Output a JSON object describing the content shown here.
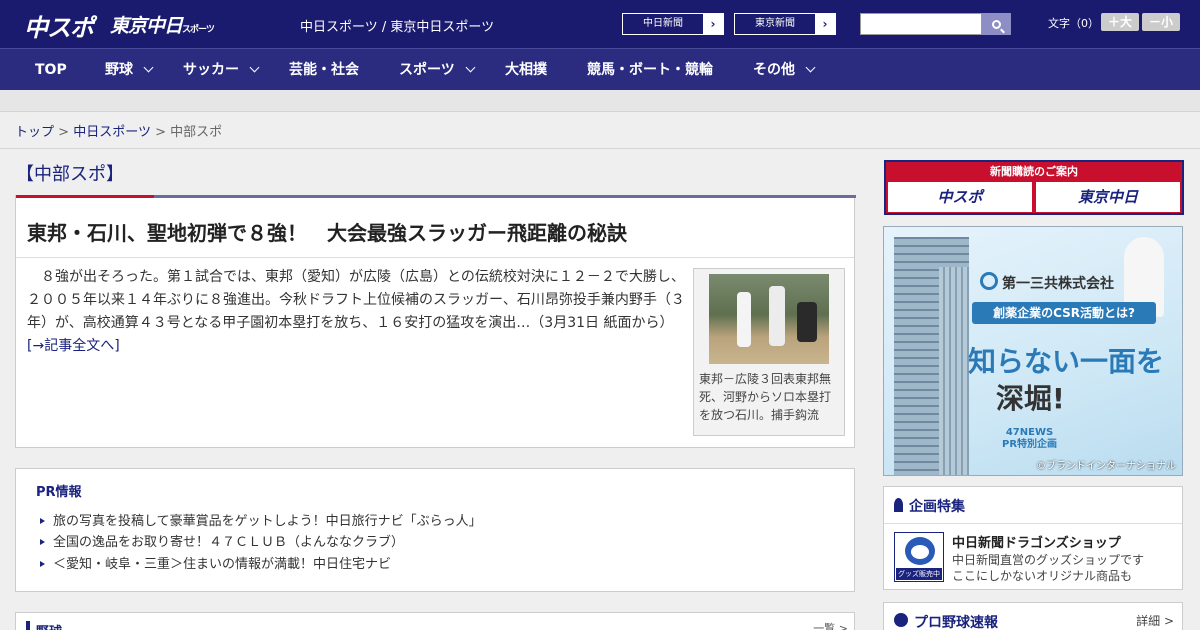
{
  "header": {
    "logo_a": "中スポ",
    "logo_b": "東京中日",
    "logo_b_small": "スポーツ",
    "site_links": "中日スポーツ / 東京中日スポーツ",
    "ext_links": [
      "中日新聞",
      "東京新聞"
    ],
    "font_size_label": "文字（0）",
    "font_plus": "＋大",
    "font_minus": "－小"
  },
  "nav": {
    "items": [
      {
        "label": "TOP",
        "chevron": false
      },
      {
        "label": "野球",
        "chevron": true
      },
      {
        "label": "サッカー",
        "chevron": true
      },
      {
        "label": "芸能・社会",
        "chevron": false
      },
      {
        "label": "スポーツ",
        "chevron": true
      },
      {
        "label": "大相撲",
        "chevron": false
      },
      {
        "label": "競馬・ボート・競輪",
        "chevron": false
      },
      {
        "label": "その他",
        "chevron": true
      }
    ]
  },
  "breadcrumb": {
    "top": "トップ",
    "sep": ">",
    "parent": "中日スポーツ",
    "current": "中部スポ"
  },
  "section_title": "【中部スポ】",
  "article": {
    "headline": "東邦・石川、聖地初弾で８強！　大会最強スラッガー飛距離の秘訣",
    "lead": "　８強が出そろった。第１試合では、東邦（愛知）が広陵（広島）との伝統校対決に１２－２で大勝し、２００５年以来１４年ぶりに８強進出。今秋ドラフト上位候補のスラッガー、石川昂弥投手兼内野手（３年）が、高校通算４３号となる甲子園初本塁打を放ち、１６安打の猛攻を演出…（3月31日 紙面から）",
    "more": "[→記事全文へ]",
    "photo_caption": "東邦－広陵３回表東邦無死、河野からソロ本塁打を放つ石川。捕手鈎流"
  },
  "pr": {
    "title": "PR情報",
    "items": [
      "旅の写真を投稿して豪華賞品をゲットしよう！中日旅行ナビ「ぶらっ人」",
      "全国の逸品をお取り寄せ！４７ＣＬＵＢ（よんななクラブ）",
      "＜愛知・岐阜・三重＞住まいの情報が満載！中日住宅ナビ"
    ]
  },
  "bottom_section": {
    "title": "野球",
    "more": "一覧 >"
  },
  "sidebar": {
    "subscription": {
      "title": "新聞購読のご案内",
      "left": "中スポ",
      "right": "東京中日"
    },
    "ad": {
      "company": "第一三共株式会社",
      "pill": "創薬企業のCSR活動とは?",
      "headline1": "知らない一面を",
      "headline2": "深堀!",
      "news_line1": "47NEWS",
      "news_line2": "PR特別企画",
      "credit": "©ブランドインターナショナル"
    },
    "feature": {
      "title": "企画特集",
      "badge": "グッズ販売中",
      "name": "中日新聞ドラゴンズショップ",
      "desc1": "中日新聞直営のグッズショップです",
      "desc2": "ここにしかないオリジナル商品も"
    },
    "npb": {
      "title": "プロ野球速報",
      "more": "詳細 >"
    }
  }
}
